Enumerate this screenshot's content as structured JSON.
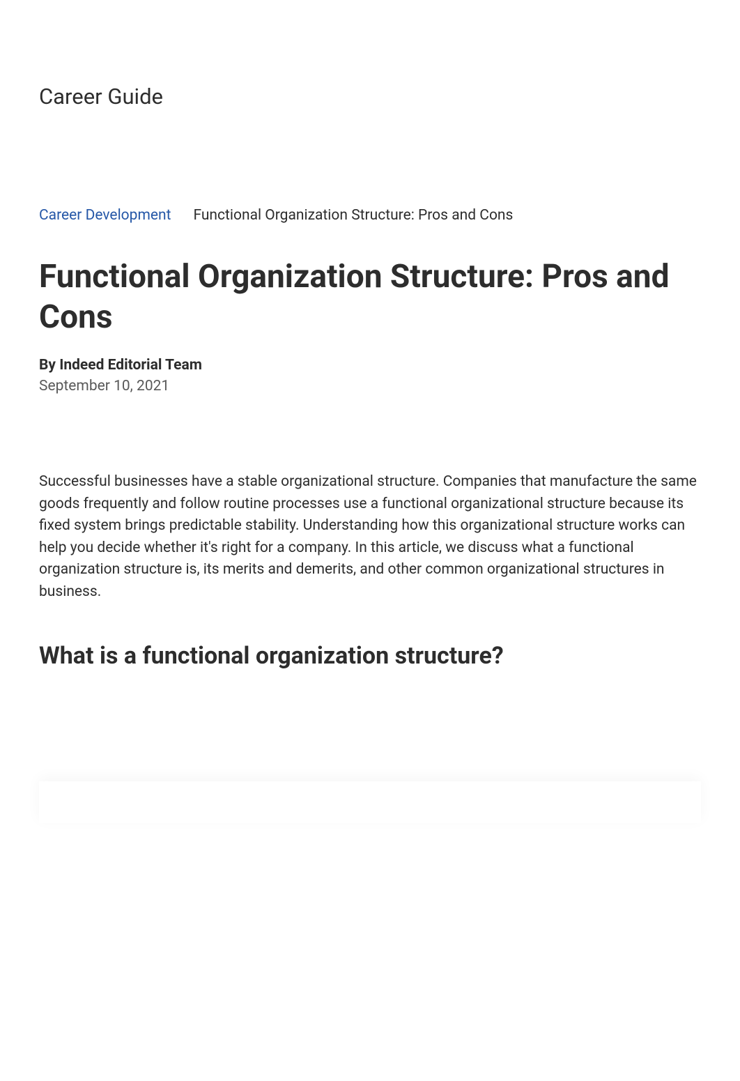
{
  "header": {
    "site_title": "Career Guide"
  },
  "breadcrumb": {
    "link_text": "Career Development",
    "current_text": "Functional Organization Structure: Pros and Cons"
  },
  "article": {
    "title": "Functional Organization Structure: Pros and Cons",
    "byline": "By Indeed Editorial Team",
    "date": "September 10, 2021",
    "intro": "Successful businesses have a stable organizational structure. Companies that manufacture the same goods frequently and follow routine processes use a functional organizational structure because its fixed system brings predictable stability. Understanding how this organizational structure works can help you decide whether it's right for a company. In this article, we discuss what a functional organization structure is, its merits and demerits, and other common organizational structures in business.",
    "section_heading": "What is a functional organization structure?"
  }
}
